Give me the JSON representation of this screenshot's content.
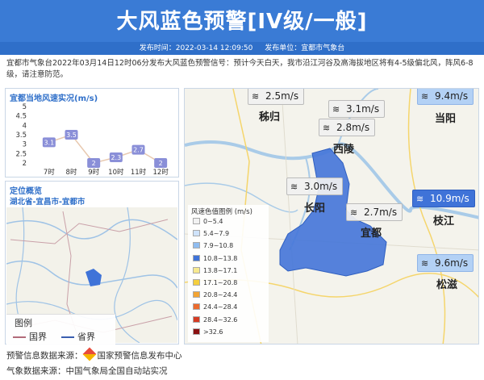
{
  "header": {
    "title": "大风蓝色预警[IV级/一般]",
    "publish_time": "发布时间：2022-03-14 12:09:50",
    "publisher": "发布单位：宜都市气象台"
  },
  "description": "宜都市气象台2022年03月14日12时06分发布大风蓝色预警信号：预计今天白天，我市沿江河谷及高海拔地区将有4-5级偏北风，阵风6-8级，请注意防范。",
  "chart_panel": {
    "title": "宜都当地风速实况(m/s)"
  },
  "chart_data": {
    "type": "line",
    "title": "宜都当地风速实况(m/s)",
    "categories": [
      "7时",
      "8时",
      "9时",
      "10时",
      "11时",
      "12时"
    ],
    "series": [
      {
        "values": [
          3.1,
          3.5,
          2,
          2.3,
          2.7,
          2
        ]
      }
    ],
    "data_labels": [
      "3.1",
      "3.5",
      "2",
      "2.3",
      "2.7",
      "2"
    ],
    "yticks": [
      "5",
      "4.5",
      "4",
      "3.5",
      "3",
      "2.5",
      "2"
    ],
    "ylim": [
      2,
      5
    ],
    "grid": false
  },
  "locate_panel": {
    "title": "定位概览",
    "region": "湖北省-宜昌市-宜都市",
    "legend_title": "图例",
    "legend_national": "国界",
    "legend_provincial": "省界"
  },
  "map": {
    "wind_labels": [
      {
        "text": "2.5m/s",
        "style": "grey"
      },
      {
        "text": "3.1m/s",
        "style": "grey"
      },
      {
        "text": "2.8m/s",
        "style": "grey"
      },
      {
        "text": "9.4m/s",
        "style": "blue"
      },
      {
        "text": "3.0m/s",
        "style": "grey"
      },
      {
        "text": "2.7m/s",
        "style": "grey"
      },
      {
        "text": "10.9m/s",
        "style": "dblue"
      },
      {
        "text": "9.6m/s",
        "style": "blue"
      }
    ],
    "cities": [
      "秭归",
      "当阳",
      "西陵",
      "长阳",
      "宜都",
      "枝江",
      "松滋"
    ],
    "speed_legend_title": "风速色值图例 (m/s)",
    "speed_legend": [
      {
        "label": "0~5.4",
        "color": "#f2f2f2"
      },
      {
        "label": "5.4~7.9",
        "color": "#cfe3fb"
      },
      {
        "label": "7.9~10.8",
        "color": "#8fbcf0"
      },
      {
        "label": "10.8~13.8",
        "color": "#3f73d8"
      },
      {
        "label": "13.8~17.1",
        "color": "#f7e98f"
      },
      {
        "label": "17.1~20.8",
        "color": "#f5cf3d"
      },
      {
        "label": "20.8~24.4",
        "color": "#f3a433"
      },
      {
        "label": "24.4~28.4",
        "color": "#ec6b2d"
      },
      {
        "label": "28.4~32.6",
        "color": "#d53b23"
      },
      {
        "label": ">32.6",
        "color": "#8a1010"
      }
    ]
  },
  "footer": {
    "line1_prefix": "预警信息数据来源：",
    "line1_source": "国家预警信息发布中心",
    "line2": "气象数据来源：中国气象局全国自动站实况"
  },
  "colors": {
    "header": "#3a7bd5",
    "subbar": "#2f6fc9",
    "accent": "#2f6fc9",
    "warning_area": "#3f73d8"
  }
}
